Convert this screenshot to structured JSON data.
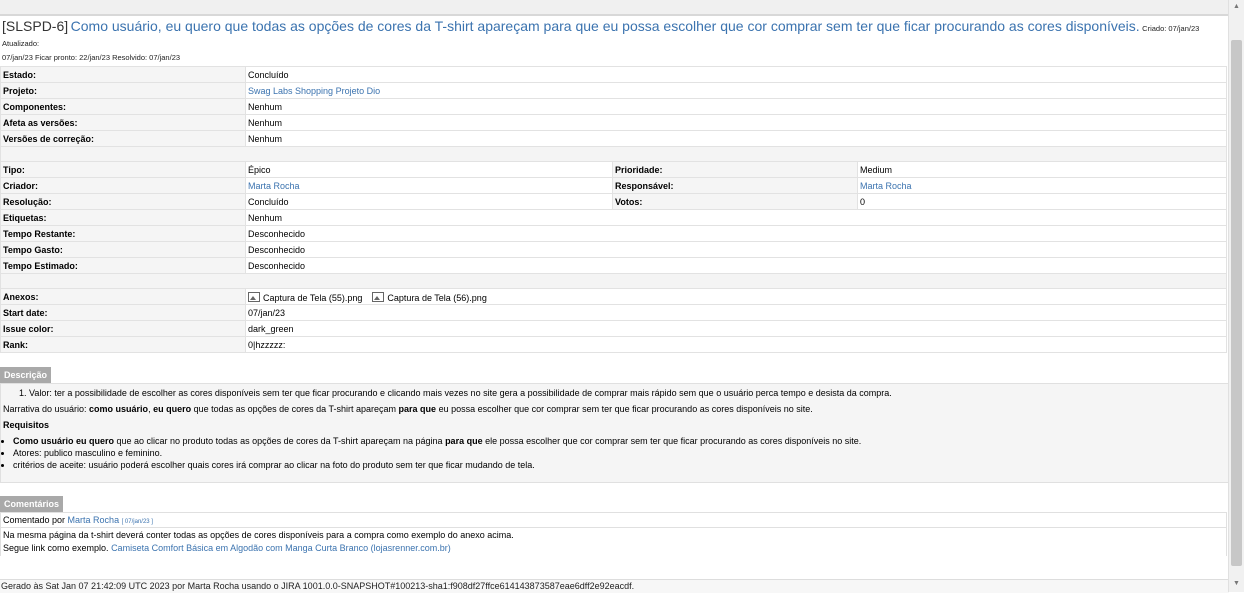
{
  "header": {
    "key": "[SLSPD-6]",
    "summary": "Como usuário, eu quero que todas as opções de cores da T-shirt apareçam para que eu possa escolher que cor comprar sem ter que ficar procurando as cores disponíveis.",
    "created": "Criado: 07/jan/23",
    "updated": "Atualizado:",
    "line2": "07/jan/23  Ficar pronto: 22/jan/23  Resolvido: 07/jan/23"
  },
  "fields1": [
    {
      "label": "Estado:",
      "value": "Concluído"
    },
    {
      "label": "Projeto:",
      "value": "Swag Labs Shopping Projeto Dio"
    },
    {
      "label": "Componentes:",
      "value": "Nenhum"
    },
    {
      "label": "Afeta as versões:",
      "value": "Nenhum"
    },
    {
      "label": "Versões de correção:",
      "value": "Nenhum"
    }
  ],
  "fields2": {
    "tipo": {
      "label": "Tipo:",
      "value": "Épico"
    },
    "prioridade": {
      "label": "Prioridade:",
      "value": "Medium"
    },
    "criador": {
      "label": "Criador:",
      "value": "Marta Rocha"
    },
    "responsavel": {
      "label": "Responsável:",
      "value": "Marta Rocha"
    },
    "resolucao": {
      "label": "Resolução:",
      "value": "Concluído"
    },
    "votos": {
      "label": "Votos:",
      "value": "0"
    },
    "etiquetas": {
      "label": "Etiquetas:",
      "value": "Nenhum"
    },
    "restante": {
      "label": "Tempo Restante:",
      "value": "Desconhecido"
    },
    "gasto": {
      "label": "Tempo Gasto:",
      "value": "Desconhecido"
    },
    "estimado": {
      "label": "Tempo Estimado:",
      "value": "Desconhecido"
    }
  },
  "fields3": {
    "anexos": {
      "label": "Anexos:",
      "file1": "Captura de Tela (55).png",
      "file2": "Captura de Tela (56).png"
    },
    "start": {
      "label": "Start date:",
      "value": "07/jan/23"
    },
    "color": {
      "label": "Issue color:",
      "value": "dark_green"
    },
    "rank": {
      "label": "Rank:",
      "value": "0|hzzzzz:"
    }
  },
  "description": {
    "title": "Descrição",
    "item1": "Valor: ter a possibilidade de escolher as cores disponíveis sem ter que ficar procurando e clicando mais vezes no site gera a possibilidade de comprar mais rápido sem que o usuário perca tempo e desista da compra.",
    "narr_a": "Narrativa do usuário: ",
    "narr_b": "como usuário",
    "narr_c": ", ",
    "narr_d": "eu quero",
    "narr_e": " que todas as opções de cores da T-shirt apareçam ",
    "narr_f": "para que",
    "narr_g": " eu possa escolher que cor comprar sem ter que ficar procurando as cores disponíveis no site.",
    "req_title": "Requisitos",
    "b1_a": "Como usuário eu quero",
    "b1_b": " que ao clicar no produto todas as opções de cores da T-shirt apareçam na página ",
    "b1_c": "para que",
    "b1_d": " ele possa escolher que cor comprar sem ter que ficar procurando as cores disponíveis no site.",
    "b2": "Atores: publico masculino e feminino.",
    "b3": "critérios de aceite: usuário poderá escolher quais cores irá comprar ao clicar na foto do produto sem ter que ficar mudando de tela."
  },
  "comments": {
    "title": "Comentários",
    "by": "Comentado por ",
    "author": "Marta Rocha",
    "date": "[ 07/jan/23 ]",
    "line1": "Na mesma página da t-shirt deverá conter todas as opções de cores disponíveis para a compra como exemplo do anexo acima.",
    "line2_a": "Segue link como exemplo. ",
    "link": "Camiseta Comfort Básica em Algodão com Manga Curta Branco (lojasrenner.com.br)"
  },
  "footer": "Gerado às Sat Jan 07 21:42:09 UTC 2023 por Marta Rocha usando o JIRA 1001.0.0-SNAPSHOT#100213-sha1:f908df27ffce614143873587eae6dff2e92eacdf.",
  "scroll": {
    "up": "▲",
    "down": "▼"
  }
}
